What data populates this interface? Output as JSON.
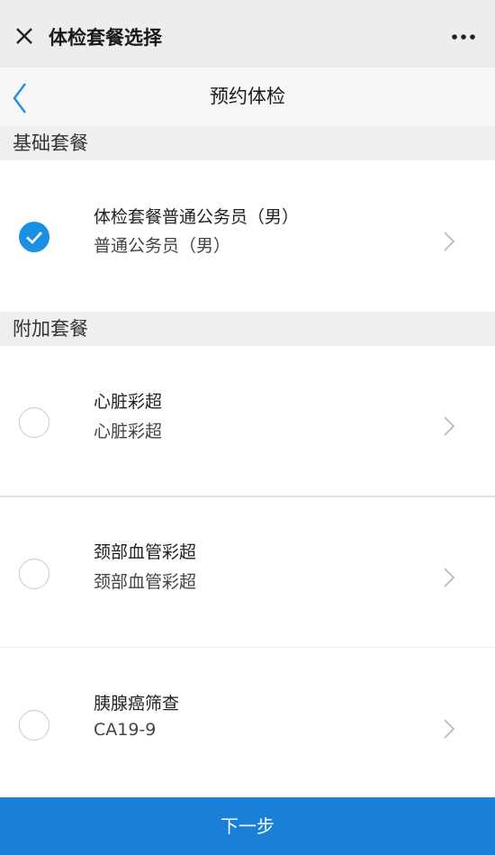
{
  "titlebar": {
    "title": "体检套餐选择",
    "close_icon": "close-icon",
    "more_icon": "more-icon"
  },
  "navbar": {
    "title": "预约体检",
    "back_icon": "chevron-left-icon"
  },
  "sections": [
    {
      "header": "基础套餐",
      "items": [
        {
          "title": "体检套餐普通公务员（男）",
          "subtitle": "普通公务员（男）",
          "selected": true
        }
      ]
    },
    {
      "header": "附加套餐",
      "items": [
        {
          "title": "心脏彩超",
          "subtitle": "心脏彩超",
          "selected": false
        },
        {
          "title": "颈部血管彩超",
          "subtitle": "颈部血管彩超",
          "selected": false
        },
        {
          "title": "胰腺癌筛查",
          "subtitle": "CA19-9",
          "selected": false
        }
      ]
    }
  ],
  "footer": {
    "next_label": "下一步"
  },
  "colors": {
    "accent": "#1a8fe3",
    "footer_bg": "#1a7fd6",
    "section_bg": "#efefef"
  }
}
